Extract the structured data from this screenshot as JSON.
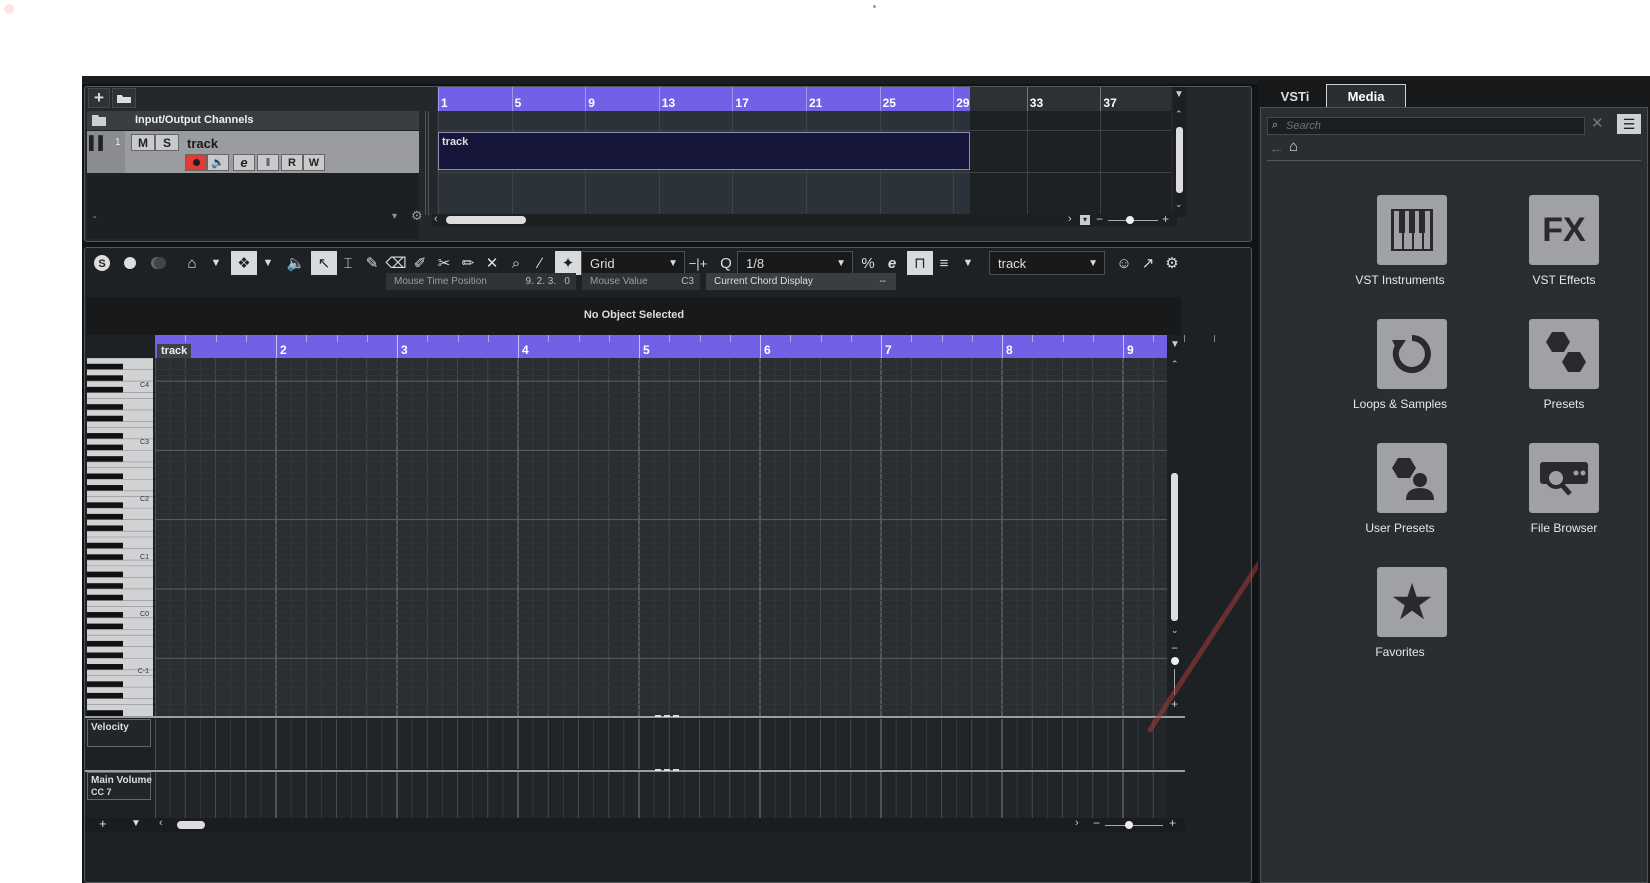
{
  "project": {
    "io_label": "Input/Output Channels",
    "track_number": "1",
    "track_name": "track",
    "mute": "M",
    "solo": "S",
    "read": "R",
    "write": "W",
    "edit_e": "e",
    "event_name": "track",
    "dash": "-",
    "ruler_marks": [
      "1",
      "5",
      "9",
      "13",
      "17",
      "21",
      "25",
      "29",
      "33",
      "37"
    ]
  },
  "editor": {
    "snap_type": "Grid",
    "quantize": "1/8",
    "track_select": "track",
    "mouse_time_label": "Mouse Time Position",
    "mouse_time_value": "9. 2. 3.   0",
    "mouse_value_label": "Mouse Value",
    "mouse_value_value": "C3",
    "chord_label": "Current Chord Display",
    "chord_value": "--",
    "no_object": "No Object Selected",
    "ruler_track": "track",
    "ruler_marks": [
      "2",
      "3",
      "4",
      "5",
      "6",
      "7",
      "8",
      "9"
    ],
    "key_labels": [
      "C4",
      "C3",
      "C2",
      "C1",
      "C0",
      "C-1"
    ],
    "velocity_label": "Velocity",
    "cc_label_1": "Main Volume",
    "cc_label_2": "CC 7"
  },
  "right": {
    "tab_vsti": "VSTi",
    "tab_media": "Media",
    "search_placeholder": "Search",
    "tiles": [
      {
        "label": "VST Instruments",
        "icon": "piano-icon"
      },
      {
        "label": "VST Effects",
        "icon": "fx-icon"
      },
      {
        "label": "Loops & Samples",
        "icon": "loop-icon"
      },
      {
        "label": "Presets",
        "icon": "hexagons-icon"
      },
      {
        "label": "User Presets",
        "icon": "user-preset-icon"
      },
      {
        "label": "File Browser",
        "icon": "file-browser-icon"
      },
      {
        "label": "Favorites",
        "icon": "star-icon"
      }
    ]
  },
  "colors": {
    "ruler": "#7161e6",
    "record": "#e53935",
    "panel": "#24272b"
  }
}
